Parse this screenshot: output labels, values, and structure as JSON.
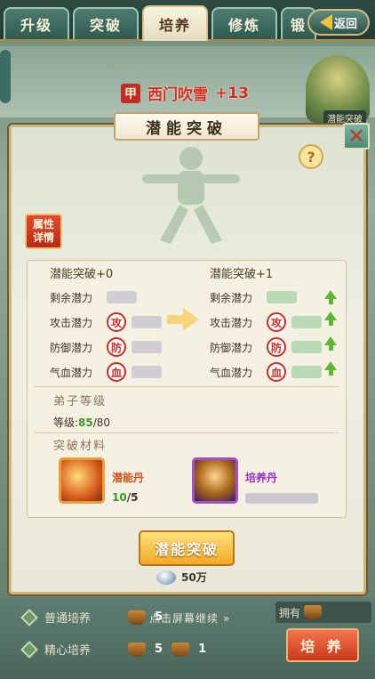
{
  "tabs": [
    {
      "label": "升级"
    },
    {
      "label": "突破"
    },
    {
      "label": "培养",
      "active": true
    },
    {
      "label": "修炼"
    },
    {
      "label": "锻"
    }
  ],
  "back_button": {
    "label": "返回"
  },
  "hero": {
    "seal": "甲",
    "name": "西门吹雪",
    "level": "+13"
  },
  "right_figure_label": "潜能突破",
  "panel": {
    "title": "潜能突破",
    "help_icon": "?",
    "attr_button": [
      "属性",
      "详情"
    ],
    "current": {
      "head": "潜能突破+0",
      "rows": [
        {
          "label": "剩余潜力"
        },
        {
          "label": "攻击潜力",
          "badge": "攻"
        },
        {
          "label": "防御潜力",
          "badge": "防"
        },
        {
          "label": "气血潜力",
          "badge": "血"
        }
      ]
    },
    "next": {
      "head": "潜能突破+1",
      "rows": [
        {
          "label": "剩余潜力"
        },
        {
          "label": "攻击潜力",
          "badge": "攻"
        },
        {
          "label": "防御潜力",
          "badge": "防"
        },
        {
          "label": "气血潜力",
          "badge": "血"
        }
      ]
    },
    "disciple_level": {
      "title": "弟子等级",
      "label": "等级:",
      "current": "85",
      "required": "/80"
    },
    "materials": {
      "title": "突破材料",
      "item_a": {
        "name": "潜能丹",
        "have": "10",
        "need": "/5"
      },
      "item_b": {
        "name": "培养丹"
      }
    },
    "break_button": "潜能突破",
    "cost": "50万"
  },
  "bottom": {
    "normal": {
      "label": "普通培养",
      "count": "5"
    },
    "careful": {
      "label": "精心培养",
      "count_a": "5",
      "count_b": "1"
    },
    "continue_hint": "点击屏幕继续",
    "have_label": "拥有",
    "cultivate_button": "培 养"
  },
  "colors": {
    "accent_gold": "#f2a926",
    "stat_red": "#d02c26",
    "up_green": "#5bb734"
  }
}
